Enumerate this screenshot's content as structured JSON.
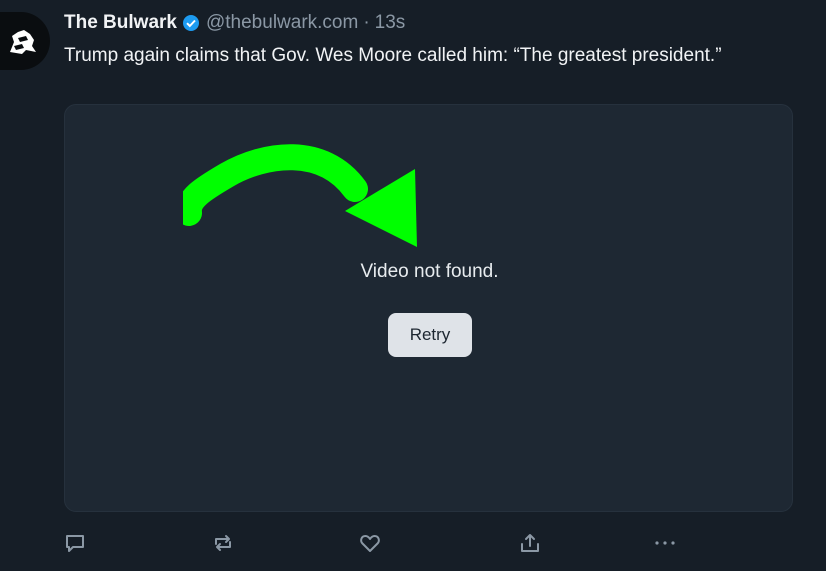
{
  "post": {
    "author": {
      "display_name": "The Bulwark",
      "handle": "@thebulwark.com",
      "verified": true,
      "avatar_icon": "bulwark-knight-logo"
    },
    "separator": "·",
    "time": "13s",
    "text": "Trump again claims that Gov. Wes Moore called him: “The greatest president.”",
    "media": {
      "overlay_icon": "green-curved-arrow-icon",
      "error_text": "Video not found.",
      "retry_label": "Retry"
    },
    "actions": [
      {
        "icon": "reply-icon"
      },
      {
        "icon": "repost-icon"
      },
      {
        "icon": "like-icon"
      },
      {
        "icon": "share-icon"
      },
      {
        "icon": "more-icon"
      }
    ]
  },
  "colors": {
    "background": "#161e27",
    "card": "#1e2833",
    "muted_text": "#8b98a5",
    "verified_blue": "#1d9bf0",
    "arrow_green": "#00ff00",
    "retry_bg": "#dfe3e8"
  }
}
